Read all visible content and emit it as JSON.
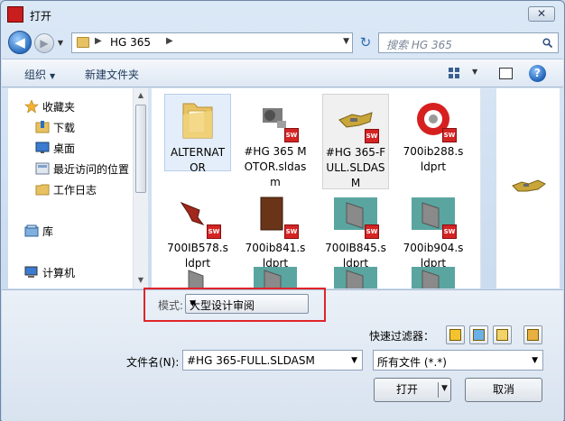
{
  "titlebar": {
    "app_icon_text": "SOLIDWORKS",
    "title": "打开",
    "close_label": "✕"
  },
  "navbar": {
    "back_label": "◀",
    "forward_label": "▶",
    "history_label": "▼",
    "address_sep1": "▶",
    "address_path": "HG 365",
    "address_sep2": "▶",
    "address_dropdown": "▼",
    "refresh_label": "↻",
    "search_placeholder": "搜索 HG 365"
  },
  "toolbar": {
    "organize_label": "组织",
    "organize_caret": "▼",
    "new_folder_label": "新建文件夹",
    "view_caret": "▼",
    "help_label": "?"
  },
  "nav_pane": {
    "items": [
      {
        "label": "收藏夹",
        "icon": "star-icon"
      },
      {
        "label": "下载",
        "icon": "download-folder-icon"
      },
      {
        "label": "桌面",
        "icon": "desktop-icon"
      },
      {
        "label": "最近访问的位置",
        "icon": "recent-places-icon"
      },
      {
        "label": "工作日志",
        "icon": "folder-icon"
      },
      {
        "label": "库",
        "icon": "library-icon"
      },
      {
        "label": "计算机",
        "icon": "computer-icon"
      }
    ],
    "scroll_up": "▲",
    "scroll_down": "▼"
  },
  "files": {
    "items": [
      {
        "name": "ALTERNATOR",
        "type": "folder"
      },
      {
        "name": "#HG 365 MOTOR.sldasm",
        "type": "assembly"
      },
      {
        "name": "#HG 365-FULL.SLDASM",
        "type": "assembly"
      },
      {
        "name": "700ib288.sldprt",
        "type": "part"
      },
      {
        "name": "700IB578.sldprt",
        "type": "part"
      },
      {
        "name": "700ib841.sldprt",
        "type": "part"
      },
      {
        "name": "700IB845.sldprt",
        "type": "part"
      },
      {
        "name": "700ib904.sldprt",
        "type": "part"
      },
      {
        "name": "",
        "type": "part"
      },
      {
        "name": "",
        "type": "part"
      },
      {
        "name": "",
        "type": "part"
      },
      {
        "name": "",
        "type": "part"
      }
    ],
    "sw_badge": "SW",
    "scroll_up": "▲",
    "scroll_down": "▼"
  },
  "bottom": {
    "mode_label": "模式:",
    "mode_value": "大型设计审阅",
    "mode_caret": "▼",
    "quick_filter_label": "快速过滤器：",
    "filename_label": "文件名(N):",
    "filename_value": "#HG 365-FULL.SLDASM",
    "filename_caret": "▼",
    "filetype_value": "所有文件 (*.*)",
    "filetype_caret": "▼",
    "open_label": "打开",
    "open_caret": "▼",
    "cancel_label": "取消"
  },
  "colors": {
    "highlight": "#e0242b",
    "sw_red": "#d42424",
    "folder": "#e8c262",
    "accent_blue": "#2c6fc0"
  }
}
